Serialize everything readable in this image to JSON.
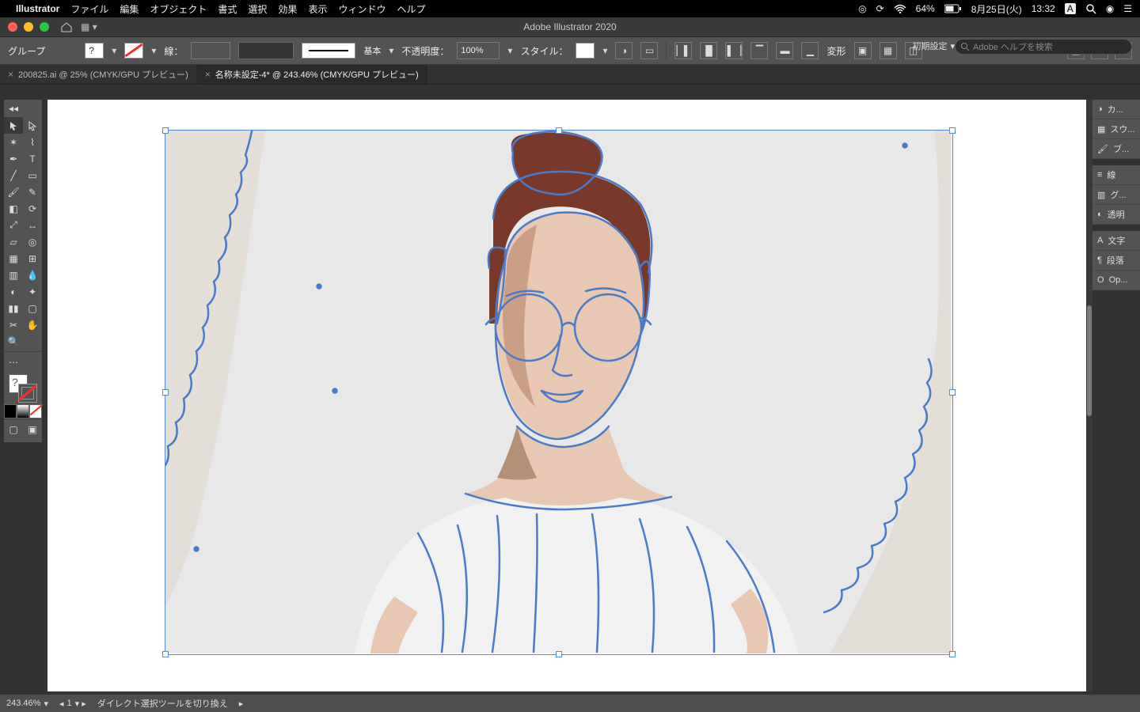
{
  "mac_menu": {
    "app_name": "Illustrator",
    "items": [
      "ファイル",
      "編集",
      "オブジェクト",
      "書式",
      "選択",
      "効果",
      "表示",
      "ウィンドウ",
      "ヘルプ"
    ],
    "right": {
      "battery": "64%",
      "date": "8月25日(火)",
      "time": "13:32",
      "input_indicator": "A"
    }
  },
  "window": {
    "title": "Adobe Illustrator 2020",
    "workspace": "初期設定",
    "search_placeholder": "Adobe ヘルプを検索"
  },
  "control_bar": {
    "selection_label": "グループ",
    "stroke_label": "線：",
    "stroke_style_label": "基本",
    "opacity_label": "不透明度：",
    "opacity_value": "100%",
    "style_label": "スタイル：",
    "transform_label": "変形"
  },
  "doc_tabs": [
    {
      "label": "200825.ai @ 25% (CMYK/GPU プレビュー)",
      "active": false
    },
    {
      "label": "名称未設定-4* @ 243.46% (CMYK/GPU プレビュー)",
      "active": true
    }
  ],
  "right_panels": {
    "items": [
      {
        "icon": "color-icon",
        "label": "カ..."
      },
      {
        "icon": "swatches-icon",
        "label": "スウ..."
      },
      {
        "icon": "brushes-icon",
        "label": "ブ..."
      },
      {
        "gap": true
      },
      {
        "icon": "stroke-icon",
        "label": "線"
      },
      {
        "icon": "gradient-icon",
        "label": "グ..."
      },
      {
        "icon": "transparency-icon",
        "label": "透明"
      },
      {
        "gap": true
      },
      {
        "icon": "character-icon",
        "label": "文字"
      },
      {
        "icon": "paragraph-icon",
        "label": "段落"
      },
      {
        "icon": "opentype-icon",
        "label": "Op..."
      }
    ]
  },
  "status_bar": {
    "zoom": "243.46%",
    "artboard": "1",
    "hint": "ダイレクト選択ツールを切り換え"
  },
  "artwork": {
    "colors": {
      "skin_light": "#e8c8b3",
      "skin_mid": "#c9a086",
      "skin_shadow": "#b58f76",
      "hair": "#78392a",
      "bg_cream": "#e3ded8",
      "bg_pale": "#e9e8e9",
      "shirt": "#f2f1f1",
      "edge": "#4a7ac8"
    }
  }
}
